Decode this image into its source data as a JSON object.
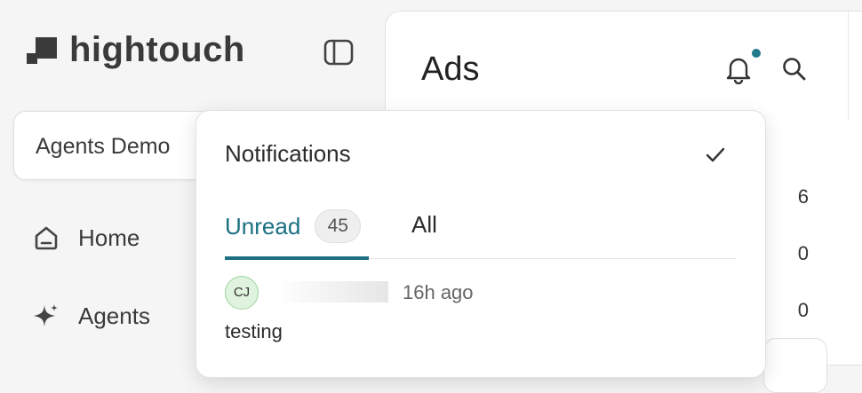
{
  "sidebar": {
    "logo_text": "hightouch",
    "workspace": "Agents Demo",
    "items": [
      {
        "label": "Home",
        "icon": "home-icon"
      },
      {
        "label": "Agents",
        "icon": "sparkle-icon"
      }
    ]
  },
  "main": {
    "title": "Ads",
    "numbers": [
      "6",
      "0",
      "0"
    ]
  },
  "notifications": {
    "title": "Notifications",
    "tabs": [
      {
        "label": "Unread",
        "count": "45",
        "active": true
      },
      {
        "label": "All",
        "active": false
      }
    ],
    "items": [
      {
        "avatar_initials": "CJ",
        "time": "16h ago",
        "message": "testing"
      }
    ]
  },
  "colors": {
    "accent": "#1b7083",
    "notification_dot": "#1f7a8c",
    "sidebar_bg": "#f5f5f5",
    "panel_bg": "#ffffff"
  }
}
